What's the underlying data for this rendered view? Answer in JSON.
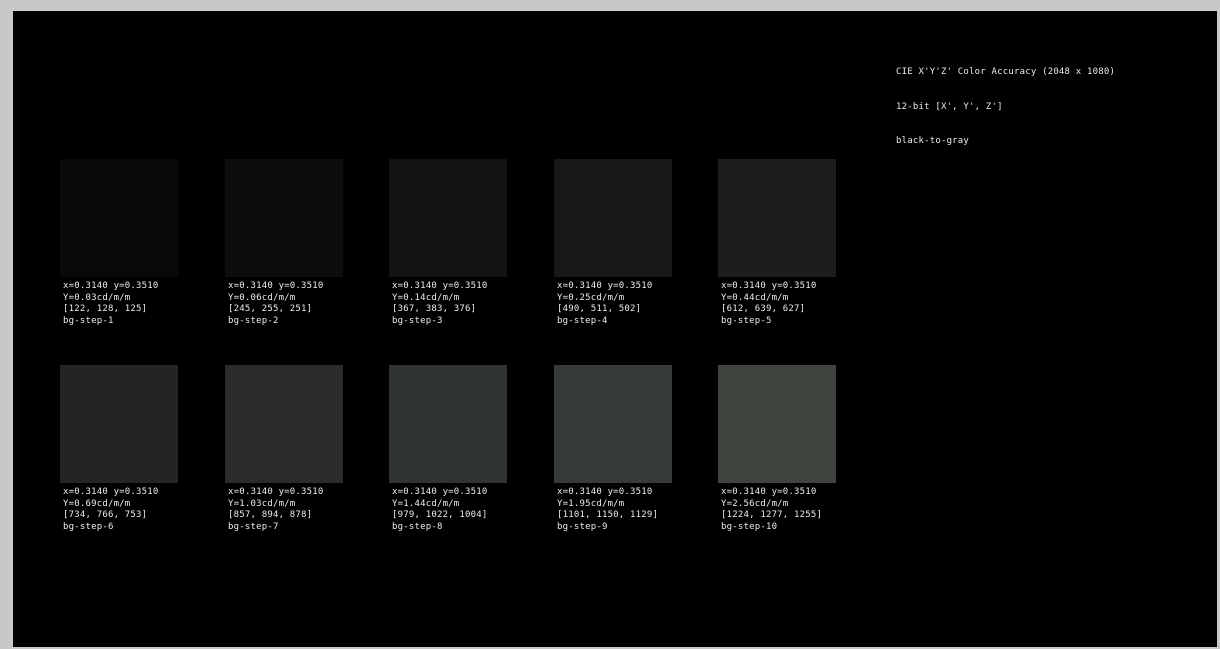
{
  "header": {
    "title": "CIE X'Y'Z' Color Accuracy (2048 x 1080)",
    "bit_depth": "12-bit [X', Y', Z']",
    "subtitle": "black-to-gray"
  },
  "tiles": [
    {
      "xy": "x=0.3140 y=0.3510",
      "luminance": "Y=0.03cd/m/m",
      "xyz": "[122, 128, 125]",
      "name": "bg-step-1",
      "color": "#080908"
    },
    {
      "xy": "x=0.3140 y=0.3510",
      "luminance": "Y=0.06cd/m/m",
      "xyz": "[245, 255, 251]",
      "name": "bg-step-2",
      "color": "#0c0d0c"
    },
    {
      "xy": "x=0.3140 y=0.3510",
      "luminance": "Y=0.14cd/m/m",
      "xyz": "[367, 383, 376]",
      "name": "bg-step-3",
      "color": "#111311"
    },
    {
      "xy": "x=0.3140 y=0.3510",
      "luminance": "Y=0.25cd/m/m",
      "xyz": "[490, 511, 502]",
      "name": "bg-step-4",
      "color": "#161816"
    },
    {
      "xy": "x=0.3140 y=0.3510",
      "luminance": "Y=0.44cd/m/m",
      "xyz": "[612, 639, 627]",
      "name": "bg-step-5",
      "color": "#1c1e1c"
    },
    {
      "xy": "x=0.3140 y=0.3510",
      "luminance": "Y=0.69cd/m/m",
      "xyz": "[734, 766, 753]",
      "name": "bg-step-6",
      "color": "#222522"
    },
    {
      "xy": "x=0.3140 y=0.3510",
      "luminance": "Y=1.03cd/m/m",
      "xyz": "[857, 894, 878]",
      "name": "bg-step-7",
      "color": "#292c29"
    },
    {
      "xy": "x=0.3140 y=0.3510",
      "luminance": "Y=1.44cd/m/m",
      "xyz": "[979, 1022, 1004]",
      "name": "bg-step-8",
      "color": "#303430"
    },
    {
      "xy": "x=0.3140 y=0.3510",
      "luminance": "Y=1.95cd/m/m",
      "xyz": "[1101, 1150, 1129]",
      "name": "bg-step-9",
      "color": "#373b37"
    },
    {
      "xy": "x=0.3140 y=0.3510",
      "luminance": "Y=2.56cd/m/m",
      "xyz": "[1224, 1277, 1255]",
      "name": "bg-step-10",
      "color": "#3f443f"
    }
  ]
}
